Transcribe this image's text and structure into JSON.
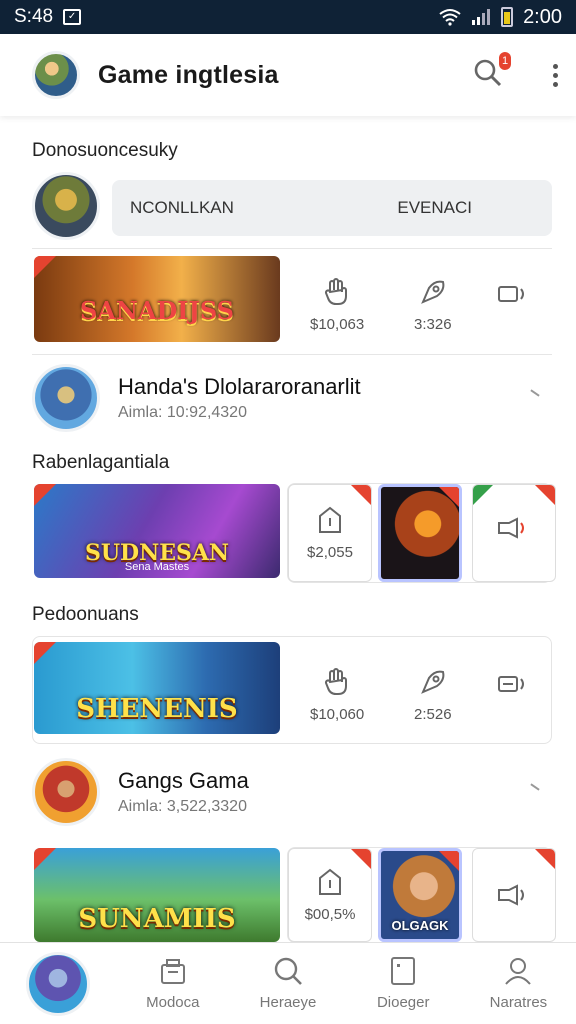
{
  "status_bar": {
    "time_left": "S:48",
    "time_right": "2:00"
  },
  "app_bar": {
    "title": "Game ingtlesia",
    "notification_count": "1"
  },
  "section1": {
    "label": "Donosuoncesuky",
    "pill_left": "NCONLLKAN",
    "pill_right": "EVENACI",
    "banner_text": "SANADIJSS",
    "stats": [
      {
        "icon": "hand-icon",
        "value": "$10,063"
      },
      {
        "icon": "rocket-icon",
        "value": "3:326"
      },
      {
        "icon": "speaker-icon",
        "value": ""
      }
    ]
  },
  "list_item1": {
    "name": "Handa's Dlolararoranarlit",
    "sub": "Aimla: 10:92,4320"
  },
  "section2": {
    "label": "Rabenlagantiala",
    "banner_text": "SUDNESAN",
    "banner_sub": "Sena Mastes",
    "tile1_value": "$2,055",
    "tile3_value": ""
  },
  "section3": {
    "label": "Pedoonuans",
    "banner_text": "SHENENIS",
    "stats": [
      {
        "icon": "hand-icon",
        "value": "$10,060"
      },
      {
        "icon": "rocket-icon",
        "value": "2:526"
      },
      {
        "icon": "speaker-icon",
        "value": ""
      }
    ]
  },
  "list_item2": {
    "name": "Gangs Gama",
    "sub": "Aimla: 3,522,3320"
  },
  "section4": {
    "banner_text": "SUNAMIIS",
    "tile1_value": "$00,5%",
    "tile2_caption": "OLGAGK"
  },
  "bottom_nav": [
    {
      "label": "",
      "icon": "avatar"
    },
    {
      "label": "Modoca",
      "icon": "gift-icon"
    },
    {
      "label": "Heraeye",
      "icon": "search-icon"
    },
    {
      "label": "Dioeger",
      "icon": "tablet-icon"
    },
    {
      "label": "Naratres",
      "icon": "user-icon"
    }
  ],
  "colors": {
    "status_bar": "#0f2236",
    "accent_red": "#e5432f",
    "pill_bg": "#eef0f2"
  }
}
